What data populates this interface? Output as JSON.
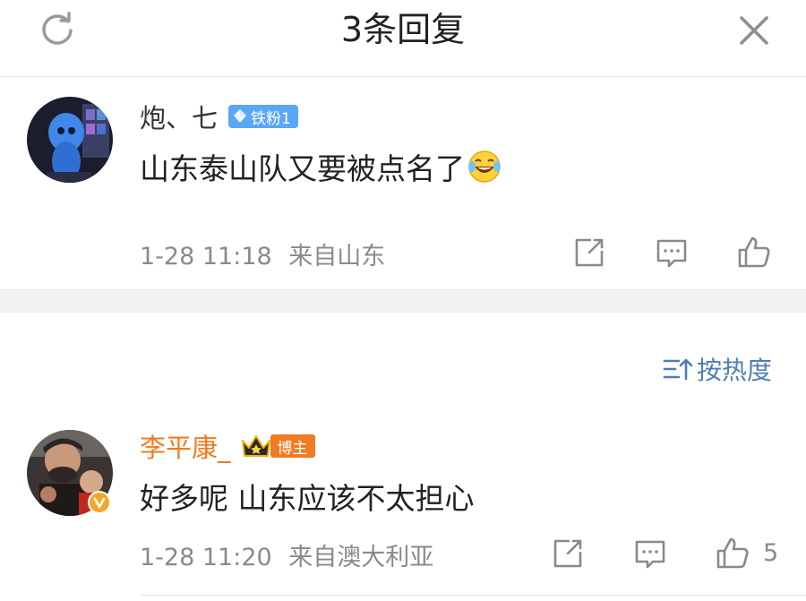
{
  "header": {
    "title": "3条回复",
    "refresh_icon": "refresh-icon",
    "close_icon": "close-icon"
  },
  "comments": [
    {
      "username": "炮、七",
      "badge": "铁粉1",
      "text": "山东泰山队又要被点名了",
      "emoji": "laugh-cry-emoji",
      "time": "1-28 11:18",
      "location": "来自山东",
      "like_count": ""
    },
    {
      "username": "李平康_",
      "badge": "博主",
      "text": "好多呢 山东应该不太担心",
      "time": "1-28 11:20",
      "location": "来自澳大利亚",
      "like_count": "5"
    }
  ],
  "sort": {
    "label": "按热度",
    "icon": "sort-icon"
  },
  "colors": {
    "accent_blue": "#4f7fae",
    "host_orange": "#f07b22",
    "fan_blue": "#5aa7f5",
    "meta_gray": "#8a8a8a"
  }
}
